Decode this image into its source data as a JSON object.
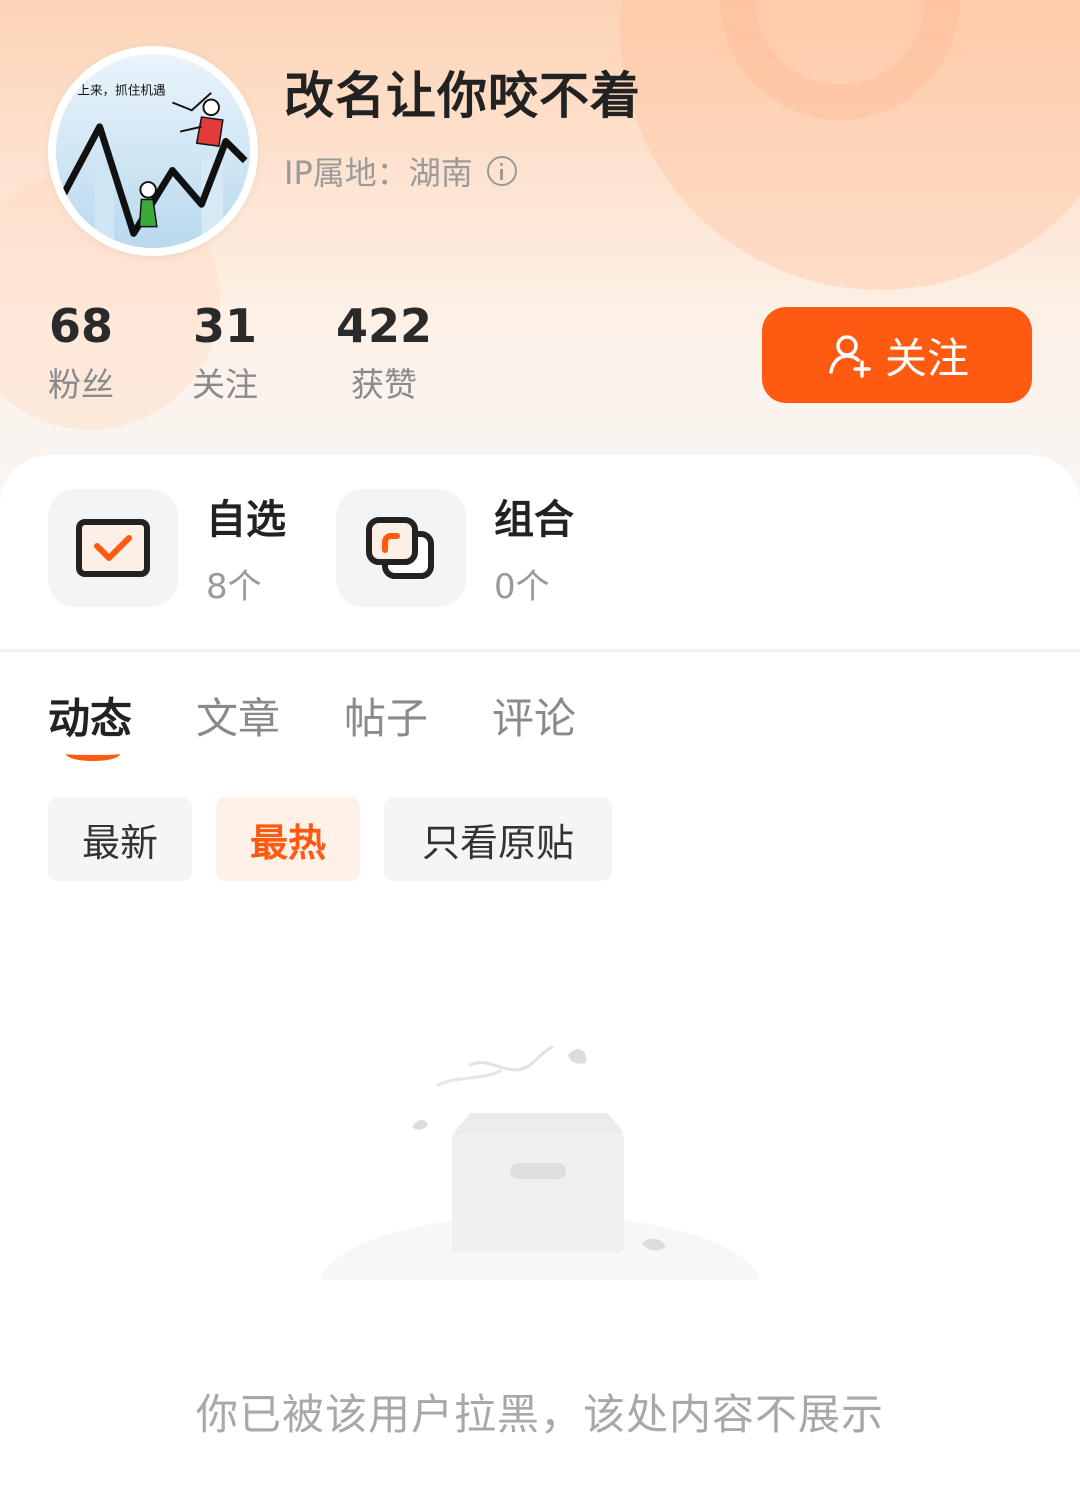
{
  "profile": {
    "username": "改名让你咬不着",
    "ip_location": "IP属地：湖南",
    "avatar_caption": "上来，抓住机遇"
  },
  "stats": [
    {
      "value": "68",
      "label": "粉丝"
    },
    {
      "value": "31",
      "label": "关注"
    },
    {
      "value": "422",
      "label": "获赞"
    }
  ],
  "follow_button": {
    "label": "关注"
  },
  "quick_links": [
    {
      "title": "自选",
      "count": "8个",
      "icon": "checklist-icon"
    },
    {
      "title": "组合",
      "count": "0个",
      "icon": "portfolio-icon"
    }
  ],
  "tabs": [
    {
      "label": "动态",
      "active": true
    },
    {
      "label": "文章",
      "active": false
    },
    {
      "label": "帖子",
      "active": false
    },
    {
      "label": "评论",
      "active": false
    }
  ],
  "filters": [
    {
      "label": "最新",
      "active": false
    },
    {
      "label": "最热",
      "active": true
    },
    {
      "label": "只看原贴",
      "active": false
    }
  ],
  "empty_state": {
    "message": "你已被该用户拉黑，该处内容不展示"
  },
  "colors": {
    "accent": "#fe5a12",
    "accent_light": "#fff0e8"
  }
}
